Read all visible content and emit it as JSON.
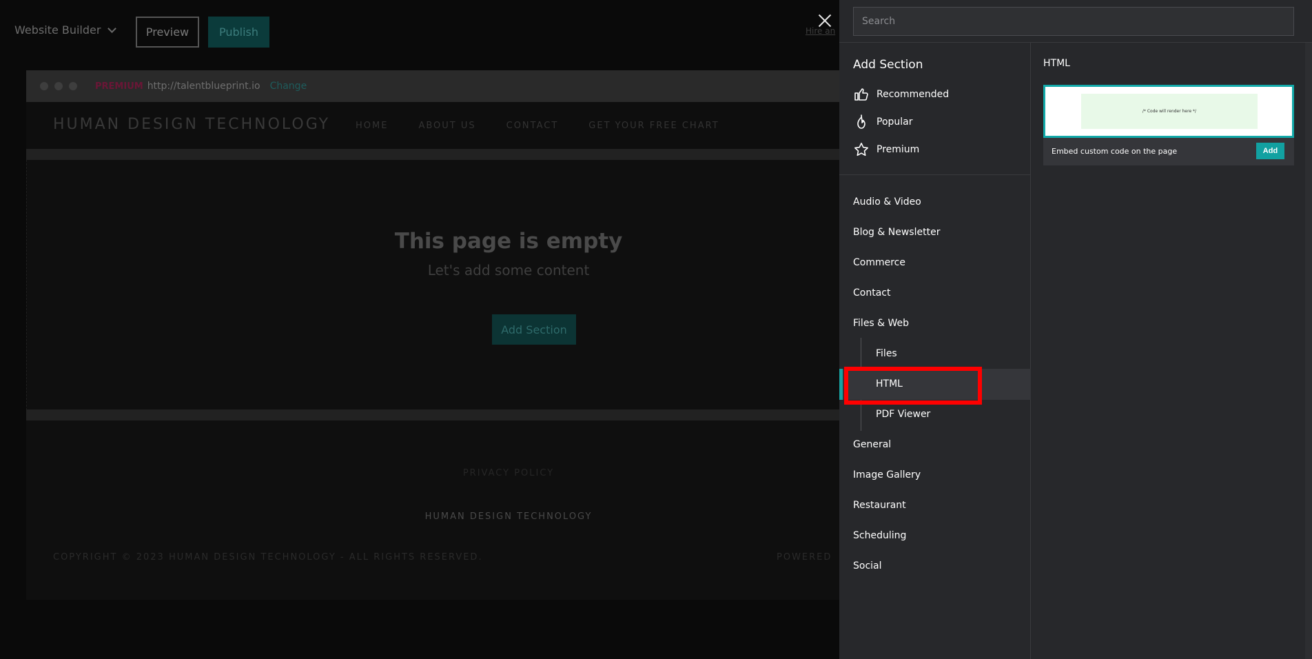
{
  "editor": {
    "builder_menu": "Website Builder",
    "preview_label": "Preview",
    "publish_label": "Publish",
    "hire_link": "Hire an",
    "browser": {
      "premium": "PREMIUM",
      "url": "http://talentblueprint.io",
      "change": "Change"
    },
    "site": {
      "logo": "HUMAN DESIGN TECHNOLOGY",
      "nav": [
        "HOME",
        "ABOUT US",
        "CONTACT",
        "GET YOUR FREE CHART"
      ],
      "empty_title": "This page is empty",
      "empty_subtitle": "Let's add some content",
      "add_section_button": "Add Section",
      "privacy": "PRIVACY POLICY",
      "footer_brand": "HUMAN DESIGN TECHNOLOGY",
      "copyright": "COPYRIGHT © 2023 HUMAN DESIGN TECHNOLOGY - ALL RIGHTS RESERVED.",
      "powered": "POWERED"
    }
  },
  "panel": {
    "search_placeholder": "Search",
    "title": "Add Section",
    "quick": [
      {
        "label": "Recommended",
        "icon": "thumbs-up-icon"
      },
      {
        "label": "Popular",
        "icon": "flame-icon"
      },
      {
        "label": "Premium",
        "icon": "star-icon"
      }
    ],
    "categories": [
      "Audio & Video",
      "Blog & Newsletter",
      "Commerce",
      "Contact",
      "Files & Web"
    ],
    "sub_items": [
      "Files",
      "HTML",
      "PDF Viewer"
    ],
    "categories_after": [
      "General",
      "Image Gallery",
      "Restaurant",
      "Scheduling",
      "Social"
    ],
    "selected": "HTML",
    "detail": {
      "title": "HTML",
      "code_placeholder": "/* Code will render here */",
      "description": "Embed custom code on the page",
      "add_label": "Add"
    }
  },
  "colors": {
    "accent": "#12a9a9",
    "highlight": "#ff0000",
    "panel_bg": "#27282b"
  }
}
